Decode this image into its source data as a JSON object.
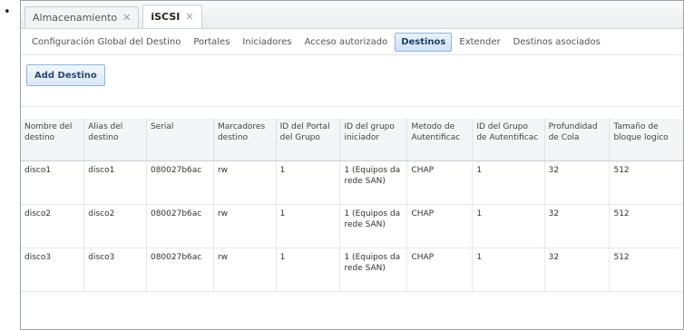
{
  "bullet": "•",
  "tabs": [
    {
      "label": "Almacenamiento",
      "close": "✕"
    },
    {
      "label": "iSCSI",
      "close": "✕"
    }
  ],
  "subnav": [
    "Configuración Global del Destino",
    "Portales",
    "Iniciadores",
    "Acceso autorizado",
    "Destinos",
    "Extender",
    "Destinos asociados"
  ],
  "active_subnav": "Destinos",
  "toolbar": {
    "add_label": "Add Destino"
  },
  "table": {
    "headers": [
      "Nombre del destino",
      "Alias del destino",
      "Serial",
      "Marcadores destino",
      "ID del Portal del Grupo",
      "ID del grupo iniciador",
      "Metodo de Autentificac",
      "ID del Grupo de Autentificac",
      "Profundidad de Cola",
      "Tamaño de bloque logico"
    ],
    "rows": [
      [
        "disco1",
        "disco1",
        "080027b6ac",
        "rw",
        "1",
        "1 (Equipos da rede SAN)",
        "CHAP",
        "1",
        "32",
        "512"
      ],
      [
        "disco2",
        "disco2",
        "080027b6ac",
        "rw",
        "1",
        "1 (Equipos da rede SAN)",
        "CHAP",
        "1",
        "32",
        "512"
      ],
      [
        "disco3",
        "disco3",
        "080027b6ac",
        "rw",
        "1",
        "1 (Equipos da rede SAN)",
        "CHAP",
        "1",
        "32",
        "512"
      ]
    ]
  }
}
